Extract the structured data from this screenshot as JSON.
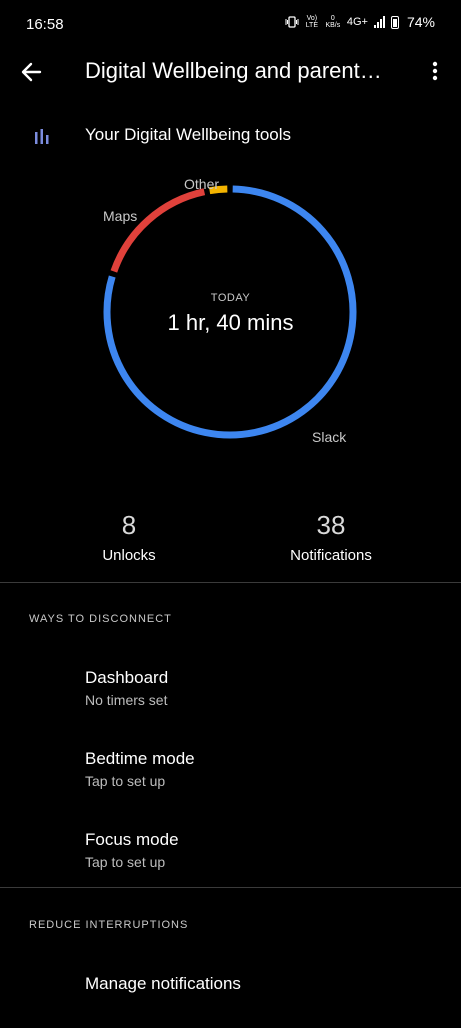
{
  "status_bar": {
    "time": "16:58",
    "volte": "Vo) LTE",
    "data_rate": "0 KB/s",
    "network": "4G+",
    "battery": "74%"
  },
  "app_bar": {
    "title": "Digital Wellbeing and parent…",
    "back_icon": "arrow-left-icon",
    "overflow_icon": "more-vert-icon"
  },
  "tools": {
    "label": "Your Digital Wellbeing tools",
    "icon": "bar-chart-icon",
    "icon_color": "#7b8cde"
  },
  "chart_data": {
    "type": "pie",
    "style": "donut",
    "center_caption": "TODAY",
    "center_value": "1 hr, 40 mins",
    "slices": [
      {
        "label": "Slack",
        "value": 80,
        "color": "#3d86f0"
      },
      {
        "label": "Maps",
        "value": 17,
        "color": "#e0413b"
      },
      {
        "label": "Other",
        "value": 3,
        "color": "#f4b400"
      }
    ]
  },
  "stats": {
    "unlocks": {
      "value": "8",
      "label": "Unlocks"
    },
    "notifications": {
      "value": "38",
      "label": "Notifications"
    }
  },
  "disconnect": {
    "header": "WAYS TO DISCONNECT",
    "items": [
      {
        "title": "Dashboard",
        "subtitle": "No timers set"
      },
      {
        "title": "Bedtime mode",
        "subtitle": "Tap to set up"
      },
      {
        "title": "Focus mode",
        "subtitle": "Tap to set up"
      }
    ]
  },
  "interruptions": {
    "header": "REDUCE INTERRUPTIONS",
    "items": [
      {
        "title": "Manage notifications"
      }
    ]
  }
}
